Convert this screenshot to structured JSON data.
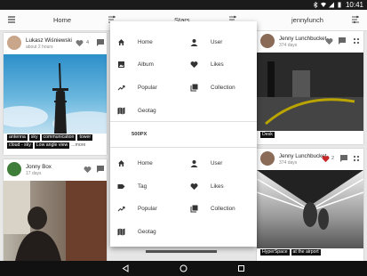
{
  "status": {
    "time": "10:41"
  },
  "appbar": {
    "tab_home": "Home",
    "tab_stars": "Stars",
    "tab_user": "jennylunch"
  },
  "cards": {
    "left_top": {
      "user": "Lukasz Wiśniewski",
      "time": "about 2 hours",
      "likes": "4",
      "tags": [
        "antenna",
        "sky",
        "communication",
        "tower",
        "cloud - sky",
        "Low angle view"
      ],
      "more": "...more"
    },
    "left_bottom": {
      "user": "Jonny Box",
      "time": "17 days"
    },
    "right_top": {
      "user": "Jenny Lunchbucket",
      "time": "374 days",
      "tag": "Desk"
    },
    "right_bottom": {
      "user": "Jenny Lunchbucket",
      "time": "374 days",
      "likes": "2",
      "tags": [
        "HyperSpace",
        "at the airport"
      ]
    }
  },
  "menu": {
    "section1": [
      {
        "label": "Home",
        "icon": "home-icon"
      },
      {
        "label": "User",
        "icon": "person-icon"
      },
      {
        "label": "Album",
        "icon": "photo-album-icon"
      },
      {
        "label": "Likes",
        "icon": "heart-icon"
      },
      {
        "label": "Popular",
        "icon": "trending-icon"
      },
      {
        "label": "Collection",
        "icon": "collection-icon"
      },
      {
        "label": "Geotag",
        "icon": "map-icon"
      }
    ],
    "section_title": "500PX",
    "section2": [
      {
        "label": "Home",
        "icon": "home-icon"
      },
      {
        "label": "User",
        "icon": "person-icon"
      },
      {
        "label": "Tag",
        "icon": "tag-icon"
      },
      {
        "label": "Likes",
        "icon": "heart-icon"
      },
      {
        "label": "Popular",
        "icon": "trending-icon"
      },
      {
        "label": "Collection",
        "icon": "collection-icon"
      },
      {
        "label": "Geotag",
        "icon": "map-icon"
      }
    ]
  }
}
